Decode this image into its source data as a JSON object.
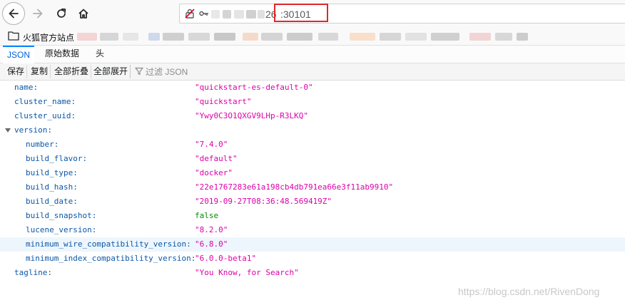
{
  "nav": {
    "back_icon": "arrow-left-icon",
    "forward_icon": "arrow-right-icon",
    "reload_icon": "reload-icon",
    "home_icon": "home-icon"
  },
  "urlbar": {
    "host_suffix": "26",
    "port": ":30101",
    "highlight_color": "#e0262a"
  },
  "bookmarks": {
    "first_label": "火狐官方站点"
  },
  "tabs": [
    {
      "label": "JSON",
      "active": true
    },
    {
      "label": "原始数据",
      "active": false
    },
    {
      "label": "头",
      "active": false
    }
  ],
  "toolbar": {
    "save": "保存",
    "copy": "复制",
    "collapse_all": "全部折叠",
    "expand_all": "全部展开",
    "filter_placeholder": "过滤 JSON"
  },
  "json_rows": [
    {
      "key": "name:",
      "value": "\"quickstart-es-default-0\"",
      "type": "string",
      "depth": 0
    },
    {
      "key": "cluster_name:",
      "value": "\"quickstart\"",
      "type": "string",
      "depth": 0
    },
    {
      "key": "cluster_uuid:",
      "value": "\"Ywy0C3O1QXGV9LHp-R3LKQ\"",
      "type": "string",
      "depth": 0
    },
    {
      "key": "version:",
      "value": "",
      "type": "object",
      "depth": 0,
      "expanded": true
    },
    {
      "key": "number:",
      "value": "\"7.4.0\"",
      "type": "string",
      "depth": 1
    },
    {
      "key": "build_flavor:",
      "value": "\"default\"",
      "type": "string",
      "depth": 1
    },
    {
      "key": "build_type:",
      "value": "\"docker\"",
      "type": "string",
      "depth": 1
    },
    {
      "key": "build_hash:",
      "value": "\"22e1767283e61a198cb4db791ea66e3f11ab9910\"",
      "type": "string",
      "depth": 1
    },
    {
      "key": "build_date:",
      "value": "\"2019-09-27T08:36:48.569419Z\"",
      "type": "string",
      "depth": 1
    },
    {
      "key": "build_snapshot:",
      "value": "false",
      "type": "bool",
      "depth": 1
    },
    {
      "key": "lucene_version:",
      "value": "\"8.2.0\"",
      "type": "string",
      "depth": 1
    },
    {
      "key": "minimum_wire_compatibility_version:",
      "value": "\"6.8.0\"",
      "type": "string",
      "depth": 1,
      "hover": true
    },
    {
      "key": "minimum_index_compatibility_version:",
      "value": "\"6.0.0-beta1\"",
      "type": "string",
      "depth": 1
    },
    {
      "key": "tagline:",
      "value": "\"You Know, for Search\"",
      "type": "string",
      "depth": 0
    }
  ],
  "colors": {
    "key": "#0b57a8",
    "string": "#dd00a9",
    "bool": "#058b00",
    "active_tab": "#0a84ff"
  },
  "watermark": "https://blog.csdn.net/RivenDong"
}
